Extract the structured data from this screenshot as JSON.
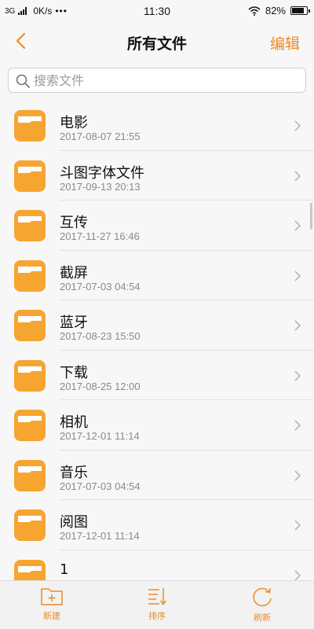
{
  "status_bar": {
    "network": "3G",
    "speed": "0K/s",
    "dots": "•••",
    "time": "11:30",
    "battery": "82%",
    "battery_level": 0.82
  },
  "nav": {
    "title": "所有文件",
    "edit_label": "编辑",
    "accent_color": "#f08a24"
  },
  "search": {
    "placeholder": "搜索文件",
    "value": ""
  },
  "files": [
    {
      "name": "电影",
      "date": "2017-08-07 21:55",
      "icon": "folder-icon"
    },
    {
      "name": "斗图字体文件",
      "date": "2017-09-13 20:13",
      "icon": "folder-icon"
    },
    {
      "name": "互传",
      "date": "2017-11-27 16:46",
      "icon": "folder-icon"
    },
    {
      "name": "截屏",
      "date": "2017-07-03 04:54",
      "icon": "folder-icon"
    },
    {
      "name": "蓝牙",
      "date": "2017-08-23 15:50",
      "icon": "folder-icon"
    },
    {
      "name": "下载",
      "date": "2017-08-25 12:00",
      "icon": "folder-icon"
    },
    {
      "name": "相机",
      "date": "2017-12-01 11:14",
      "icon": "folder-icon"
    },
    {
      "name": "音乐",
      "date": "2017-07-03 04:54",
      "icon": "folder-icon"
    },
    {
      "name": "阅图",
      "date": "2017-12-01 11:14",
      "icon": "folder-icon"
    },
    {
      "name": "1",
      "date": "",
      "icon": "folder-icon"
    }
  ],
  "toolbar": {
    "new_label": "新建",
    "sort_label": "排序",
    "refresh_label": "刷新"
  }
}
